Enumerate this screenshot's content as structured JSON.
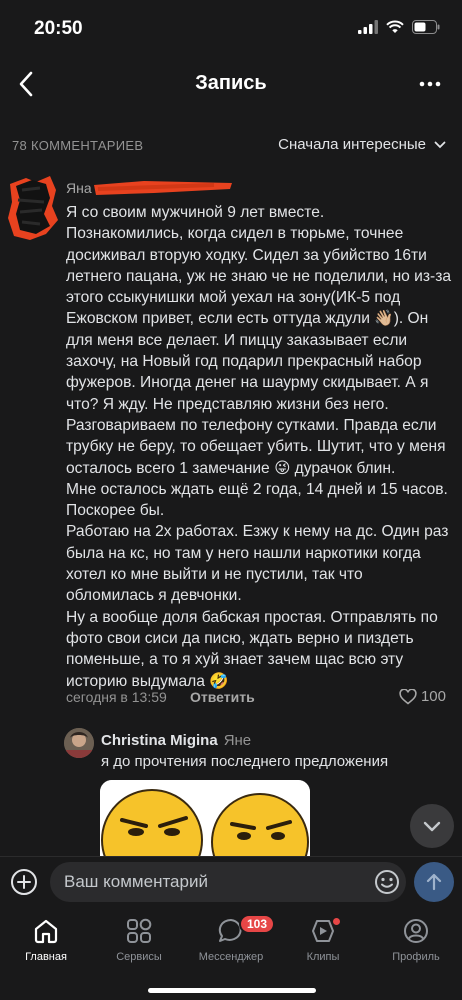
{
  "status_bar": {
    "time": "20:50"
  },
  "nav": {
    "title": "Запись"
  },
  "comments": {
    "count_label": "78 КОММЕНТАРИЕВ",
    "sort_label": "Сначала интересные"
  },
  "main_comment": {
    "author": "Яна",
    "text": "Я со своим мужчиной 9 лет вместе.\nПознакомились, когда сидел в тюрьме, точнее досиживал вторую ходку. Сидел за убийство 16ти летнего пацана, уж не знаю че не поделили, но из-за этого ссыкунишки мой уехал на зону(ИК-5 под Ежовском привет, если есть оттуда ждули 👋🏼). Он для меня все делает. И пиццу заказывает если захочу, на Новый год подарил прекрасный набор фужеров. Иногда денег на шаурму скидывает. А я что? Я жду. Не представляю жизни без него. Разговариваем по телефону сутками. Правда если трубку не беру, то обещает убить. Шутит, что у меня осталось всего 1 замечание 😜 дурачок блин.\nМне осталось ждать ещё 2 года, 14 дней и 15 часов. Поскорее бы.\nРаботаю на 2х работах. Езжу к нему на дс. Один раз была на кс, но там у него нашли наркотики когда хотел ко мне выйти и не пустили, так что обломилась я девчонки.\nНу а вообще доля бабская простая. Отправлять по фото свои сиси да писю, ждать верно и пиздеть поменьше, а то я хуй знает зачем щас всю эту историю выдумала 🤣",
    "time": "сегодня в 13:59",
    "reply_label": "Ответить",
    "likes": "100"
  },
  "reply_comment": {
    "author": "Christina Migina",
    "reply_to": "Яне",
    "text": "я до прочтения последнего предложения"
  },
  "compose": {
    "placeholder": "Ваш комментарий"
  },
  "tabs": [
    {
      "label": "Главная",
      "icon": "home-icon"
    },
    {
      "label": "Сервисы",
      "icon": "services-icon"
    },
    {
      "label": "Мессенджер",
      "icon": "messenger-icon",
      "badge": "103"
    },
    {
      "label": "Клипы",
      "icon": "clips-icon"
    },
    {
      "label": "Профиль",
      "icon": "profile-icon"
    }
  ],
  "colors": {
    "background": "#19191a",
    "text": "#e1e3e6",
    "secondary": "#939393",
    "badge": "#e64646",
    "redaction": "#e8421f"
  }
}
